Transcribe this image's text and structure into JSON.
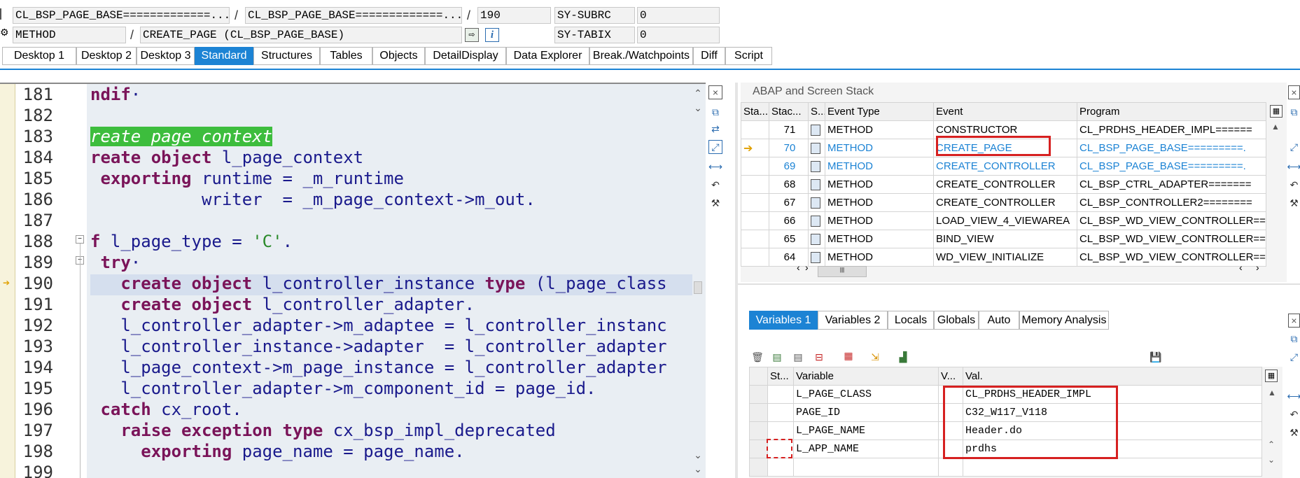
{
  "header": {
    "row1": {
      "field1": "CL_BSP_PAGE_BASE=============...",
      "sep1": "/",
      "field2": "CL_BSP_PAGE_BASE=============...",
      "sep2": "/",
      "line": "190",
      "sy1_name": "SY-SUBRC",
      "sy1_val": "0"
    },
    "row2": {
      "field1": "METHOD",
      "sep": "/",
      "field2": "CREATE_PAGE (CL_BSP_PAGE_BASE)",
      "sy2_name": "SY-TABIX",
      "sy2_val": "0"
    }
  },
  "tabs": [
    "Desktop 1",
    "Desktop 2",
    "Desktop 3",
    "Standard",
    "Structures",
    "Tables",
    "Objects",
    "DetailDisplay",
    "Data Explorer",
    "Break./Watchpoints",
    "Diff",
    "Script"
  ],
  "active_tab": "Standard",
  "code": {
    "line_numbers": [
      "181",
      "182",
      "183",
      "184",
      "185",
      "186",
      "187",
      "188",
      "189",
      "190",
      "191",
      "192",
      "193",
      "194",
      "195",
      "196",
      "197",
      "198",
      "199"
    ],
    "lines": [
      [
        {
          "t": "ndif",
          "c": "kw"
        },
        {
          "t": "·",
          "c": ""
        }
      ],
      [],
      [
        {
          "t": "reate page context",
          "c": "hl"
        }
      ],
      [
        {
          "t": "reate object ",
          "c": "kw"
        },
        {
          "t": "l_page_context",
          "c": ""
        }
      ],
      [
        {
          "t": " exporting ",
          "c": "kw"
        },
        {
          "t": "runtime = _m_runtime",
          "c": ""
        }
      ],
      [
        {
          "t": "           writer  = _m_page_context->m_out.",
          "c": ""
        }
      ],
      [],
      [
        {
          "t": "f ",
          "c": "kw"
        },
        {
          "t": "l_page_type = ",
          "c": ""
        },
        {
          "t": "'C'",
          "c": "str"
        },
        {
          "t": ".",
          "c": ""
        }
      ],
      [
        {
          "t": " try",
          "c": "kw"
        },
        {
          "t": "·",
          "c": ""
        }
      ],
      [
        {
          "t": "   create object ",
          "c": "kw"
        },
        {
          "t": "l_controller_instance ",
          "c": ""
        },
        {
          "t": "type ",
          "c": "kw"
        },
        {
          "t": "(l_page_class",
          "c": ""
        }
      ],
      [
        {
          "t": "   create object ",
          "c": "kw"
        },
        {
          "t": "l_controller_adapter.",
          "c": ""
        }
      ],
      [
        {
          "t": "   l_controller_adapter->m_adaptee = l_controller_instanc",
          "c": ""
        }
      ],
      [
        {
          "t": "   l_controller_instance->adapter  = l_controller_adapter",
          "c": ""
        }
      ],
      [
        {
          "t": "   l_page_context->m_page_instance = l_controller_adapter",
          "c": ""
        }
      ],
      [
        {
          "t": "   l_controller_adapter->m_component_id = page_id.",
          "c": ""
        }
      ],
      [
        {
          "t": " catch ",
          "c": "kw"
        },
        {
          "t": "cx_root.",
          "c": ""
        }
      ],
      [
        {
          "t": "   raise exception type ",
          "c": "kw"
        },
        {
          "t": "cx_bsp_impl_deprecated",
          "c": ""
        }
      ],
      [
        {
          "t": "     exporting ",
          "c": "kw"
        },
        {
          "t": "page_name = page_name.",
          "c": ""
        }
      ],
      []
    ]
  },
  "stack": {
    "title": "ABAP and Screen Stack",
    "columns": [
      "Sta...",
      "Stac...",
      "S...",
      "Event Type",
      "Event",
      "Program"
    ],
    "rows": [
      {
        "level": "71",
        "type": "METHOD",
        "event": "CONSTRUCTOR",
        "program": "CL_PRDHS_HEADER_IMPL======",
        "current": false,
        "link": false
      },
      {
        "level": "70",
        "type": "METHOD",
        "event": "CREATE_PAGE",
        "program": "CL_BSP_PAGE_BASE=========.",
        "current": true,
        "link": true
      },
      {
        "level": "69",
        "type": "METHOD",
        "event": "CREATE_CONTROLLER",
        "program": "CL_BSP_PAGE_BASE=========.",
        "current": false,
        "link": true
      },
      {
        "level": "68",
        "type": "METHOD",
        "event": "CREATE_CONTROLLER",
        "program": "CL_BSP_CTRL_ADAPTER=======",
        "current": false,
        "link": false
      },
      {
        "level": "67",
        "type": "METHOD",
        "event": "CREATE_CONTROLLER",
        "program": "CL_BSP_CONTROLLER2========",
        "current": false,
        "link": false
      },
      {
        "level": "66",
        "type": "METHOD",
        "event": "LOAD_VIEW_4_VIEWAREA",
        "program": "CL_BSP_WD_VIEW_CONTROLLER==",
        "current": false,
        "link": false
      },
      {
        "level": "65",
        "type": "METHOD",
        "event": "BIND_VIEW",
        "program": "CL_BSP_WD_VIEW_CONTROLLER==",
        "current": false,
        "link": false
      },
      {
        "level": "64",
        "type": "METHOD",
        "event": "WD_VIEW_INITIALIZE",
        "program": "CL_BSP_WD_VIEW_CONTROLLER==",
        "current": false,
        "link": false
      }
    ]
  },
  "var_tabs": [
    "Variables 1",
    "Variables 2",
    "Locals",
    "Globals",
    "Auto",
    "Memory Analysis"
  ],
  "active_var_tab": "Variables 1",
  "variables": {
    "columns": [
      "St...",
      "Variable",
      "V...",
      "Val."
    ],
    "rows": [
      {
        "name": "L_PAGE_CLASS",
        "value": "CL_PRDHS_HEADER_IMPL"
      },
      {
        "name": "PAGE_ID",
        "value": "C32_W117_V118"
      },
      {
        "name": "L_PAGE_NAME",
        "value": "Header.do"
      },
      {
        "name": "L_APP_NAME",
        "value": "prdhs"
      }
    ]
  },
  "colors": {
    "accent": "#1c83d4",
    "highlight": "#d62020",
    "keyword": "#7a1459",
    "string": "#2a8a2a"
  }
}
